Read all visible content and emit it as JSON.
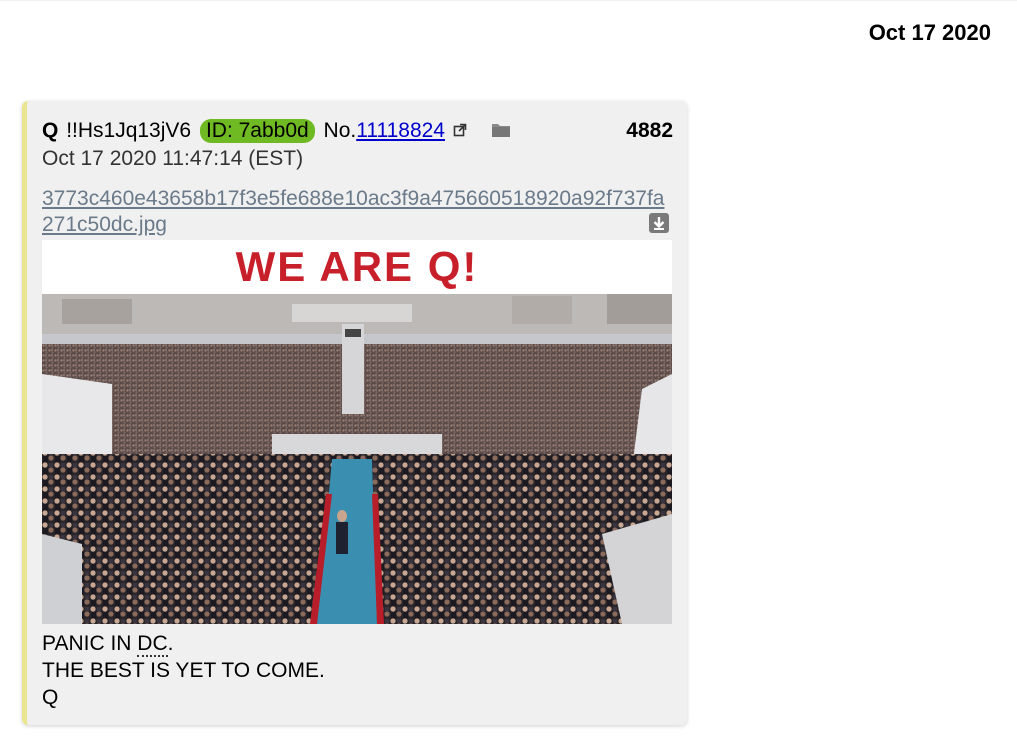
{
  "page": {
    "date_header": "Oct 17 2020"
  },
  "post": {
    "name": "Q",
    "tripcode": "!!Hs1Jq13jV6",
    "id_label": "ID: 7abb0d",
    "no_prefix": "No.",
    "post_id": "11118824",
    "post_number": "4882",
    "timestamp": "Oct 17 2020 11:47:14 (EST)",
    "filename": "3773c460e43658b17f3e5fe688e10ac3f9a475660518920a92f737fa271c50dc.jpg",
    "image_banner_text": "WE ARE Q!",
    "body": {
      "line1_prefix": "PANIC IN ",
      "line1_abbr": "DC",
      "line1_suffix": ".",
      "line2": "THE BEST IS YET TO COME.",
      "line3": "Q"
    },
    "icons": {
      "external_link": "external-link-icon",
      "folder": "folder-icon",
      "download": "download-icon"
    },
    "colors": {
      "id_badge": "#6fba22",
      "post_link": "#0000cc",
      "border_accent": "#eae690",
      "banner_text": "#c8202a"
    }
  }
}
